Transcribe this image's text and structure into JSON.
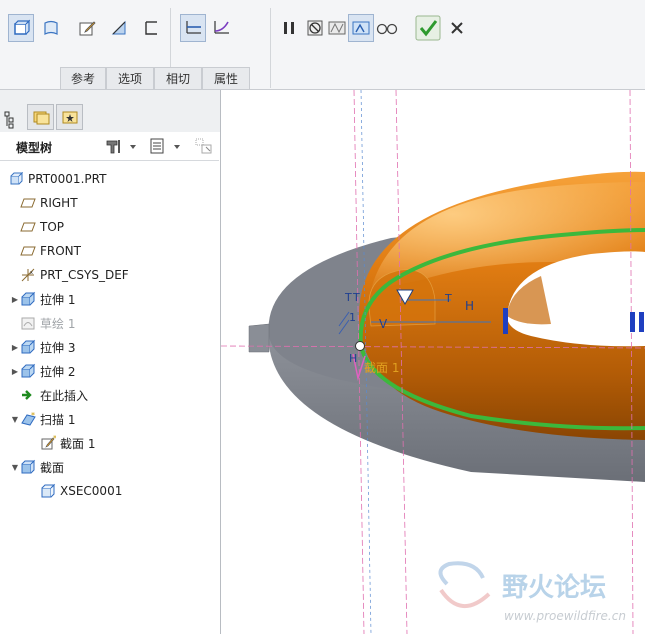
{
  "ribbon": {
    "tabs": [
      "参考",
      "选项",
      "相切",
      "属性"
    ],
    "icons": [
      "solid-icon",
      "surface-icon",
      "edit-sketch-icon",
      "remove-material-icon",
      "thicken-icon",
      "constant-section-icon",
      "variable-section-icon",
      "pause-icon",
      "no-preview-icon",
      "preview-icon",
      "verify-icon",
      "glasses-icon",
      "ok-check-icon",
      "cancel-x-icon"
    ]
  },
  "tree": {
    "title": "模型树",
    "items": [
      {
        "label": "PRT0001.PRT",
        "indent": 0,
        "icon": "part-icon"
      },
      {
        "label": "RIGHT",
        "indent": 1,
        "icon": "datum-plane-icon"
      },
      {
        "label": "TOP",
        "indent": 1,
        "icon": "datum-plane-icon"
      },
      {
        "label": "FRONT",
        "indent": 1,
        "icon": "datum-plane-icon"
      },
      {
        "label": "PRT_CSYS_DEF",
        "indent": 1,
        "icon": "csys-icon"
      },
      {
        "label": "拉伸 1",
        "indent": 1,
        "icon": "extrude-icon",
        "expand": "▶"
      },
      {
        "label": "草绘 1",
        "indent": 1,
        "icon": "sketch-icon",
        "dim": true
      },
      {
        "label": "拉伸 3",
        "indent": 1,
        "icon": "extrude-icon",
        "expand": "▶"
      },
      {
        "label": "拉伸 2",
        "indent": 1,
        "icon": "extrude-icon",
        "expand": "▶"
      },
      {
        "label": "在此插入",
        "indent": 1,
        "icon": "insert-arrow-icon"
      },
      {
        "label": "扫描 1",
        "indent": 1,
        "icon": "sweep-icon",
        "expand": "▼"
      },
      {
        "label": "截面 1",
        "indent": 2,
        "icon": "section-sketch-icon"
      },
      {
        "label": "截面",
        "indent": 1,
        "icon": "xsec-folder-icon",
        "expand": "▼"
      },
      {
        "label": "XSEC0001",
        "indent": 2,
        "icon": "xsec-icon"
      }
    ]
  },
  "viewport": {
    "annotations": {
      "h1": "H",
      "v": "V",
      "h2": "H",
      "t1": "T",
      "t2": "T",
      "t3": "T",
      "one": "1",
      "section_label": "截面 1"
    },
    "watermark": {
      "logo": "野火论坛",
      "url": "www.proewildfire.cn"
    }
  },
  "colors": {
    "torus": "#e07c12",
    "base": "#7f838c",
    "trajectory": "#3cb83c",
    "accent": "#2a5fb0"
  }
}
